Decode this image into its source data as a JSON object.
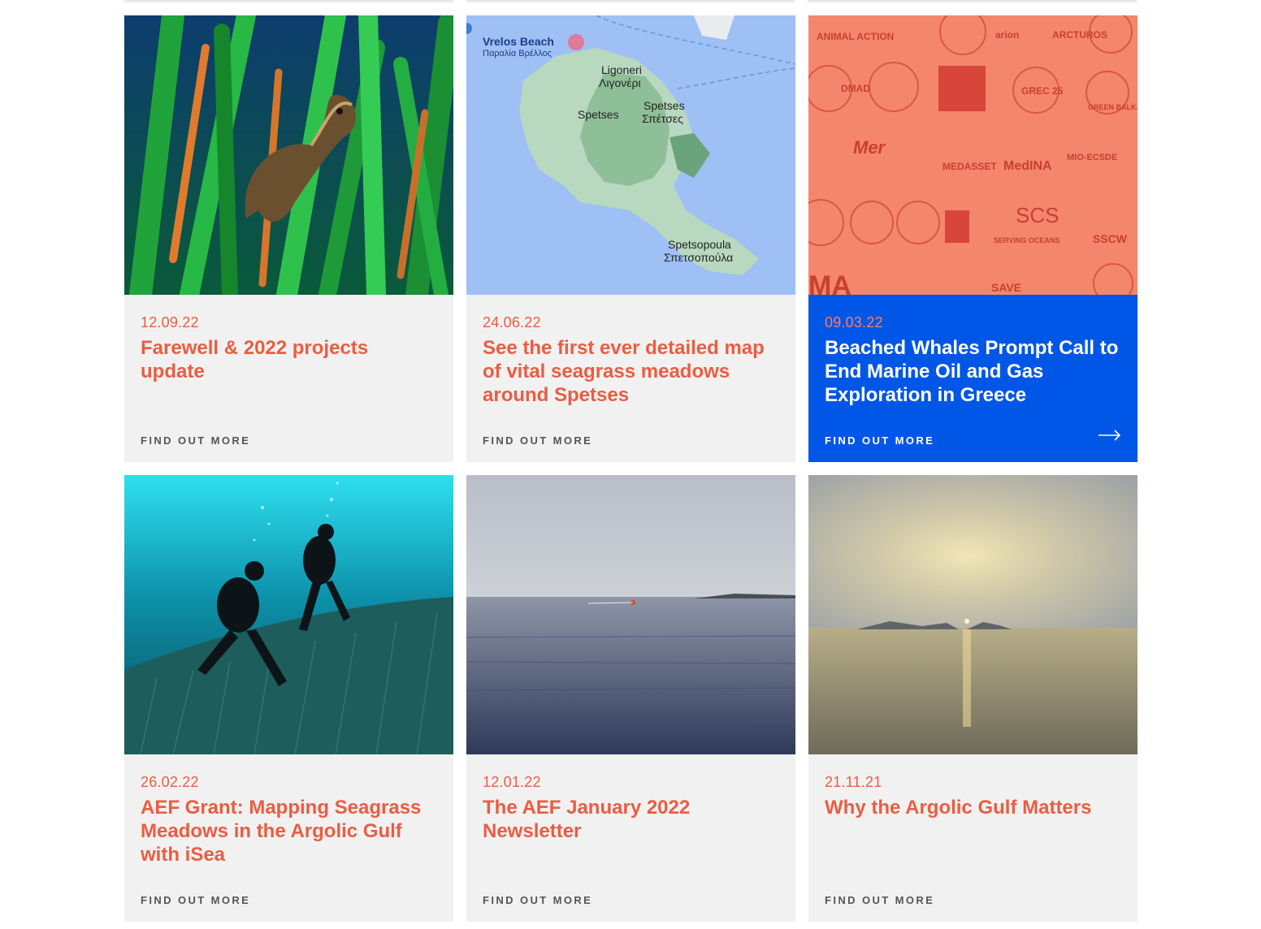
{
  "cards": [
    {
      "date": "12.09.22",
      "title": "Farewell & 2022 projects update",
      "link_label": "FIND OUT MORE",
      "image": "seahorse-in-seagrass"
    },
    {
      "date": "24.06.22",
      "title": "See the first ever detailed map of vital seagrass meadows around Spetses",
      "link_label": "FIND OUT MORE",
      "image": "spetses-map",
      "map_labels": {
        "beach_en": "Vrelos Beach",
        "beach_gr": "Παραλία Βρέλλος",
        "ligoneri_en": "Ligoneri",
        "ligoneri_gr": "Λιγονέρι",
        "spetses": "Spetses",
        "town_en": "Spetses",
        "town_gr": "Σπέτσες",
        "spetsopoula_en": "Spetsopoula",
        "spetsopoula_gr": "Σπετσοπούλα"
      }
    },
    {
      "date": "09.03.22",
      "title": "Beached Whales Prompt Call to End Marine Oil and Gas Exploration in Greece",
      "link_label": "FIND OUT MORE",
      "image": "ngo-logos-collage",
      "active": true,
      "logos": [
        "ANIMAL ACTION",
        "arion",
        "ARCTUROS",
        "DMAD",
        "GREC 25",
        "GREEN BALKANS",
        "Mer",
        "MEDASSET",
        "MedINA",
        "MIO-ECSDE",
        "SCS",
        "SERVING OCEANS",
        "SSCW",
        "SAVE",
        "MA"
      ]
    },
    {
      "date": "26.02.22",
      "title": "AEF Grant: Mapping Seagrass Meadows in the Argolic Gulf with iSea",
      "link_label": "FIND OUT MORE",
      "image": "divers-over-seagrass"
    },
    {
      "date": "12.01.22",
      "title": "The AEF January 2022 Newsletter",
      "link_label": "FIND OUT MORE",
      "image": "calm-sea-boat"
    },
    {
      "date": "21.11.21",
      "title": "Why the Argolic Gulf Matters",
      "link_label": "FIND OUT MORE",
      "image": "sunset-over-gulf"
    }
  ],
  "colors": {
    "accent": "#ea5d43",
    "active_bg": "#0057e7",
    "card_bg": "#f1f1f1"
  }
}
